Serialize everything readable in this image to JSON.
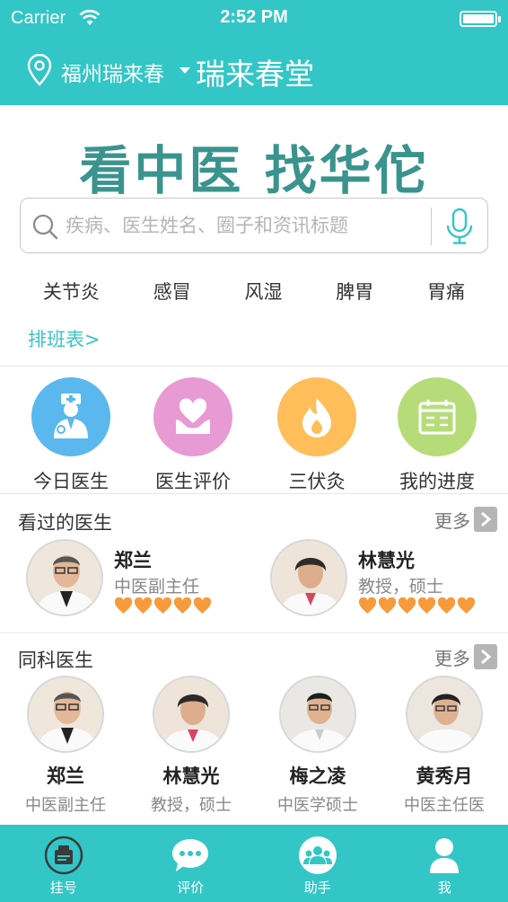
{
  "status": {
    "carrier": "Carrier",
    "time": "2:52 PM"
  },
  "header": {
    "city": "福州瑞来春",
    "hospital": "瑞来春堂"
  },
  "hero": {
    "slogan": "看中医 找华佗",
    "search_placeholder": "疾病、医生姓名、圈子和资讯标题",
    "hot_tags": [
      "关节炎",
      "感冒",
      "风湿",
      "脾胃",
      "胃痛"
    ],
    "schedule_link": "排班表>"
  },
  "features": [
    {
      "label": "今日医生",
      "icon": "doctor-icon",
      "color": "#5ab8ee"
    },
    {
      "label": "医生评价",
      "icon": "heart-hand-icon",
      "color": "#e79ad4"
    },
    {
      "label": "三伏灸",
      "icon": "flame-icon",
      "color": "#ffbe5a"
    },
    {
      "label": "我的进度",
      "icon": "calendar-icon",
      "color": "#b6dc7a"
    }
  ],
  "visited": {
    "title": "看过的医生",
    "more": "更多",
    "doctors": [
      {
        "name": "郑兰",
        "title": "中医副主任",
        "rating": 5
      },
      {
        "name": "林慧光",
        "title": "教授，硕士",
        "rating": 5
      }
    ]
  },
  "same_dept": {
    "title": "同科医生",
    "more": "更多",
    "doctors": [
      {
        "name": "郑兰",
        "title": "中医副主任"
      },
      {
        "name": "林慧光",
        "title": "教授，硕士"
      },
      {
        "name": "梅之凌",
        "title": "中医学硕士"
      },
      {
        "name": "黄秀月",
        "title": "中医主任医"
      }
    ]
  },
  "tabbar": [
    {
      "label": "挂号",
      "icon": "register-icon"
    },
    {
      "label": "评价",
      "icon": "chat-icon"
    },
    {
      "label": "助手",
      "icon": "group-icon"
    },
    {
      "label": "我",
      "icon": "person-icon"
    }
  ],
  "colors": {
    "brand": "#33c6c6",
    "slogan": "#3a948d",
    "heart": "#f79a3c"
  }
}
